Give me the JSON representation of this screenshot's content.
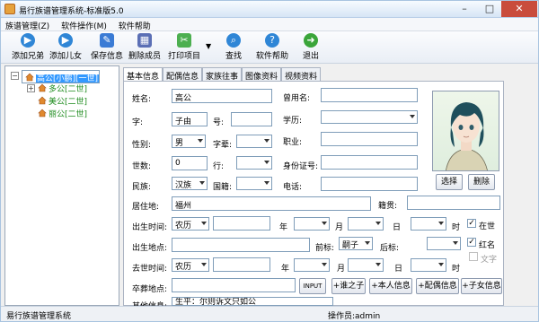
{
  "window": {
    "title": "易行族谱管理系统-标准版5.0"
  },
  "menu": [
    "族谱管理(Z)",
    "软件操作(M)",
    "软件帮助"
  ],
  "toolbar": [
    {
      "label": "添加兄弟",
      "icon": "play-circle-icon",
      "color": "#2f86d6"
    },
    {
      "label": "添加儿女",
      "icon": "play-circle-icon",
      "color": "#2f86d6"
    },
    {
      "label": "保存信息",
      "icon": "edit-icon",
      "color": "#3a7bd5"
    },
    {
      "label": "删除成员",
      "icon": "grid-icon",
      "color": "#5b6fb5"
    },
    {
      "label": "打印项目",
      "icon": "tools-icon",
      "color": "#4caf50"
    },
    {
      "label": "查找",
      "icon": "search-icon",
      "color": "#2f86d6"
    },
    {
      "label": "软件帮助",
      "icon": "help-icon",
      "color": "#2f86d6"
    },
    {
      "label": "退出",
      "icon": "exit-icon",
      "color": "#3aa53a"
    }
  ],
  "tree": {
    "root": "高公[小鹏][一世]",
    "children": [
      "多公[二世]",
      "美公[二世]",
      "丽公[二世]"
    ]
  },
  "tabs": [
    "基本信息",
    "配偶信息",
    "家族往事",
    "图像资料",
    "视频资料"
  ],
  "form": {
    "name_label": "姓名:",
    "name_value": "高公",
    "zi_label": "字:",
    "zi_value": "子由",
    "hao_label": "号:",
    "hao_value": "",
    "gender_label": "性别:",
    "gender_value": "男",
    "zibei_label": "字辈:",
    "zibei_value": "",
    "generation_label": "世数:",
    "generation_value": "0",
    "hang_label": "行:",
    "hang_value": "",
    "ethnic_label": "民族:",
    "ethnic_value": "汉族",
    "nation_label": "国籍:",
    "nation_value": "",
    "alias_label": "曾用名:",
    "alias_value": "",
    "education_label": "学历:",
    "education_value": "",
    "job_label": "职业:",
    "job_value": "",
    "idcard_label": "身份证号:",
    "idcard_value": "",
    "phone_label": "电话:",
    "phone_value": "",
    "residence_label": "居住地:",
    "residence_value": "福州",
    "origin_label": "籍贯:",
    "origin_value": "",
    "birth_time_label": "出生时间:",
    "birth_calendar": "农历",
    "birth_year_unit": "年",
    "birth_month_unit": "月",
    "birth_day_unit": "日",
    "birth_hour_unit": "时",
    "alive_label": "在世",
    "alive_checked": true,
    "birthplace_label": "出生地点:",
    "birthplace_value": "",
    "prefix_label": "前标:",
    "prefix_value": "嗣子",
    "suffix_label": "后标:",
    "suffix_value": "",
    "red_name_label": "红名",
    "red_name_checked": true,
    "text_label": "文字",
    "text_checked": false,
    "death_time_label": "去世时间:",
    "death_calendar": "农历",
    "death_year_unit": "年",
    "death_month_unit": "月",
    "death_day_unit": "日",
    "death_hour_unit": "时",
    "burial_label": "卒葬地点:",
    "burial_value": "",
    "input_button": "INPUT",
    "other_label": "其他信息:",
    "other_value": "生平：尔则诉文只如公"
  },
  "photo_buttons": {
    "choose": "选择",
    "delete": "删除"
  },
  "action_buttons": [
    "+谁之子",
    "+本人信息",
    "+配偶信息",
    "+子女信息"
  ],
  "status": {
    "left": "易行族谱管理系统",
    "operator": "操作员:admin"
  }
}
